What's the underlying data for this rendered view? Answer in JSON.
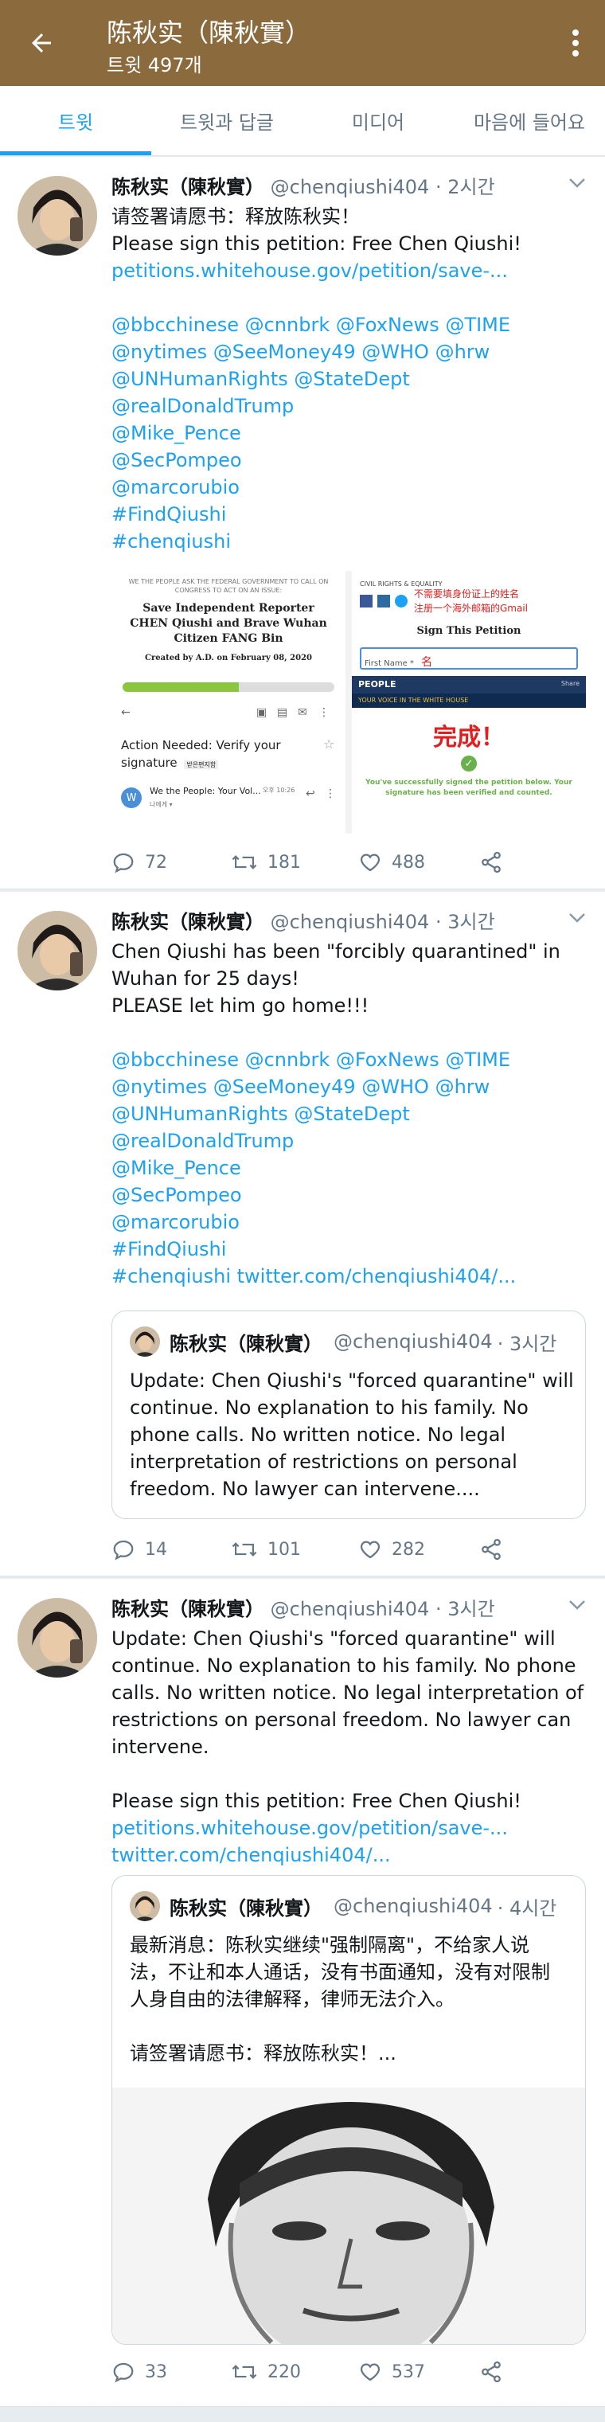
{
  "colors": {
    "header": "#8b6a3e",
    "accent": "#1da1f2"
  },
  "topbar": {
    "title": "陈秋实（陳秋實）",
    "subtitle": "트윗 497개"
  },
  "tabs": [
    {
      "label": "트윗",
      "active": true
    },
    {
      "label": "트윗과 답글"
    },
    {
      "label": "미디어"
    },
    {
      "label": "마음에 들어요"
    }
  ],
  "tweets": [
    {
      "name": "陈秋实（陳秋實）",
      "handle": "@chenqiushi404",
      "time": "· 2시간",
      "lines": [
        "请签署请愿书：释放陈秋实！",
        "Please sign this petition: Free Chen Qiushi!",
        "petitions.whitehouse.gov/petition/save-...",
        "",
        "@bbcchinese @cnnbrk @FoxNews @TIME",
        "@nytimes @SeeMoney49 @WHO @hrw",
        "@UNHumanRights @StateDept",
        "@realDonaldTrump",
        "@Mike_Pence",
        "@SecPompeo",
        "@marcorubio",
        "#FindQiushi",
        "#chenqiushi"
      ],
      "petition": {
        "banner": "WE THE PEOPLE ASK THE FEDERAL GOVERNMENT TO CALL ON CONGRESS TO ACT ON AN ISSUE:",
        "title": "Save Independent Reporter CHEN Qiushi and Brave Wuhan Citizen FANG Bin",
        "created": "Created by A.D. on February 08, 2020",
        "email_subject": "Action Needed: Verify your signature",
        "inbox_tag": "받은편지함",
        "sender": "We the People: Your Vol...",
        "sender_time": "오후 10:26",
        "sender_sub": "나에게 ▾",
        "category": "CIVIL RIGHTS & EQUALITY",
        "note_cn": "不需要填身份证上的姓名",
        "note_cn2": "注册一个海外邮箱的Gmail",
        "sign_title": "Sign This Petition",
        "first_name": "First Name *",
        "name_char": "名",
        "people": "PEOPLE",
        "share": "Share",
        "voice": "YOUR VOICE IN THE WHITE HOUSE",
        "done": "完成！",
        "success": "You've successfully signed the petition below. Your signature has been verified and counted."
      },
      "counts": {
        "reply": "72",
        "retweet": "181",
        "like": "488"
      }
    },
    {
      "name": "陈秋实（陳秋實）",
      "handle": "@chenqiushi404",
      "time": "· 3시간",
      "lines": [
        "Chen Qiushi has been \"forcibly quarantined\" in",
        "Wuhan for 25 days!",
        "PLEASE let him go home!!!",
        "",
        "@bbcchinese @cnnbrk @FoxNews @TIME",
        "@nytimes @SeeMoney49 @WHO @hrw",
        "@UNHumanRights @StateDept",
        "@realDonaldTrump",
        "@Mike_Pence",
        "@SecPompeo",
        "@marcorubio",
        "#FindQiushi",
        "#chenqiushi twitter.com/chenqiushi404/..."
      ],
      "quote": {
        "name": "陈秋实（陳秋實）",
        "handle": "@chenqiushi404",
        "time": "· 3시간",
        "lines": [
          "Update: Chen Qiushi's \"forced quarantine\" will",
          "continue. No explanation to his family. No",
          "phone calls. No written notice. No legal",
          "interpretation of restrictions on personal",
          "freedom. No lawyer can intervene...."
        ]
      },
      "counts": {
        "reply": "14",
        "retweet": "101",
        "like": "282"
      }
    },
    {
      "name": "陈秋实（陳秋實）",
      "handle": "@chenqiushi404",
      "time": "· 3시간",
      "lines": [
        "Update: Chen Qiushi's \"forced quarantine\" will",
        "continue. No explanation to his family. No phone",
        "calls. No written notice. No legal interpretation of",
        "restrictions on personal freedom. No lawyer can",
        "intervene.",
        "",
        "Please sign this petition: Free Chen Qiushi!",
        "petitions.whitehouse.gov/petition/save-...",
        "twitter.com/chenqiushi404/..."
      ],
      "quote": {
        "name": "陈秋实（陳秋實）",
        "handle": "@chenqiushi404",
        "time": "· 4시간",
        "lines": [
          "最新消息：陈秋实继续\"强制隔离\"，不给家人说",
          "法，不让和本人通话，没有书面通知，没有对限制",
          "人身自由的法律解释，律师无法介入。",
          "",
          "请签署请愿书：释放陈秋实！..."
        ]
      },
      "counts": {
        "reply": "33",
        "retweet": "220",
        "like": "537"
      }
    }
  ]
}
